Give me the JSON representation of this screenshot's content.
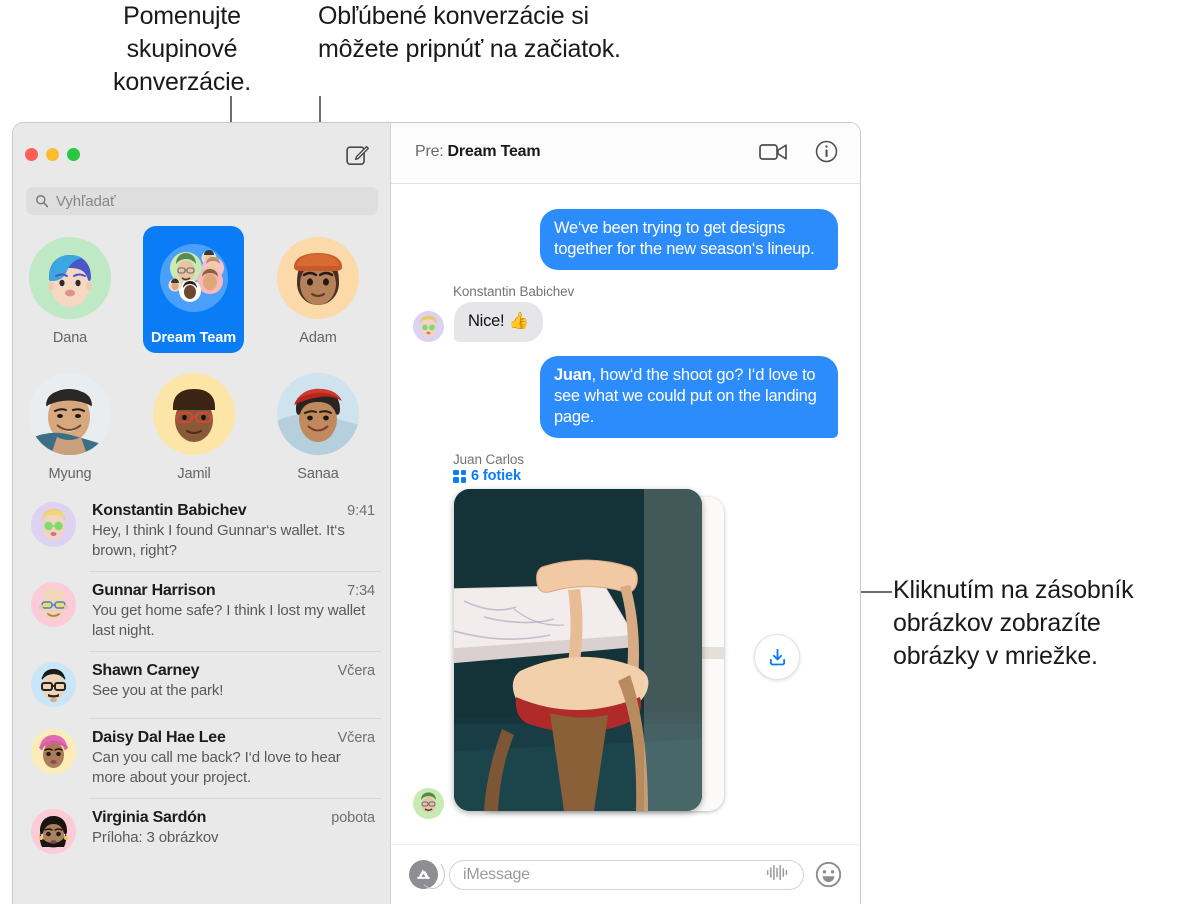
{
  "callouts": {
    "left": "Pomenujte skupinové konverzácie.",
    "middle": "Obľúbené konverzácie si môžete pripnúť na začiatok.",
    "right": "Kliknutím na zásobník obrázkov zobrazíte obrázky v mriežke."
  },
  "window": {
    "traffic_lights": {
      "close": "close-red",
      "minimize": "minimize-yellow",
      "zoom": "zoom-green"
    },
    "compose_icon": "compose-icon"
  },
  "search": {
    "placeholder": "Vyhľadať",
    "icon": "search-icon"
  },
  "pinned": [
    {
      "name": "Dana",
      "selected": false,
      "icon": "avatar-memoji-dana"
    },
    {
      "name": "Dream Team",
      "selected": true,
      "icon": "avatar-group-dream-team"
    },
    {
      "name": "Adam",
      "selected": false,
      "icon": "avatar-memoji-adam"
    },
    {
      "name": "Myung",
      "selected": false,
      "icon": "avatar-photo-myung"
    },
    {
      "name": "Jamil",
      "selected": false,
      "icon": "avatar-memoji-jamil"
    },
    {
      "name": "Sanaa",
      "selected": false,
      "icon": "avatar-photo-sanaa"
    }
  ],
  "conversations": [
    {
      "name": "Konstantin Babichev",
      "time": "9:41",
      "preview": "Hey, I think I found Gunnar‘s wallet. It‘s brown, right?"
    },
    {
      "name": "Gunnar Harrison",
      "time": "7:34",
      "preview": "You get home safe? I think I lost my wallet last night."
    },
    {
      "name": "Shawn Carney",
      "time": "Včera",
      "preview": "See you at the park!"
    },
    {
      "name": "Daisy Dal Hae Lee",
      "time": "Včera",
      "preview": "Can you call me back? I‘d love to hear more about your project."
    },
    {
      "name": "Virginia Sardón",
      "time": "pobota",
      "preview": "Príloha:  3 obrázkov"
    }
  ],
  "pane": {
    "to_label": "Pre:",
    "to_value": "Dream Team",
    "facetime_icon": "video-camera-icon",
    "info_icon": "info-circle-icon"
  },
  "messages": [
    {
      "kind": "outgoing",
      "text": "We‘ve been trying to get designs together for the new season‘s lineup."
    },
    {
      "kind": "incoming",
      "sender": "Konstantin Babichev",
      "text": "Nice!  👍"
    },
    {
      "kind": "outgoing",
      "bold_prefix": "Juan",
      "text": ", how‘d the shoot go? I‘d love to see what we could put on the landing page."
    },
    {
      "kind": "photo-stack",
      "sender": "Juan Carlos",
      "count_label": "6 fotiek",
      "grid_icon": "grid-icon",
      "download_icon": "download-icon"
    }
  ],
  "composer": {
    "apps_icon": "app-store-icon",
    "placeholder": "iMessage",
    "audio_icon": "audio-waveform-icon",
    "emoji_icon": "emoji-smiley-icon"
  },
  "colors": {
    "imessage_blue": "#2d8cfb",
    "selected_pin_blue": "#0a7cf6",
    "incoming_gray": "#e6e6e8",
    "sidebar_bg": "#e9e9e9",
    "link_blue": "#0a7cf6"
  }
}
